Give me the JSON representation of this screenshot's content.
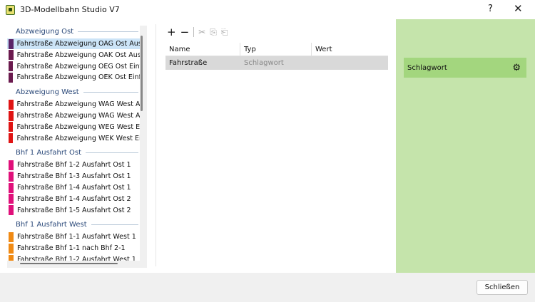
{
  "window": {
    "title": "3D-Modellbahn Studio V7",
    "help": "?",
    "close": "✕"
  },
  "list": {
    "groups": [
      {
        "label": "Abzweigung Ost",
        "color": "#6b1a4e",
        "items": [
          "Fahrstraße Abzweigung OAG Ost Ausf..",
          "Fahrstraße Abzweigung OAK Ost Ausf..",
          "Fahrstraße Abzweigung OEG Ost Einfa..",
          "Fahrstraße Abzweigung OEK Ost Einfa.."
        ]
      },
      {
        "label": "Abzweigung West",
        "color": "#e01414",
        "items": [
          "Fahrstraße Abzweigung WAG West Au..",
          "Fahrstraße Abzweigung WAG West Au..",
          "Fahrstraße Abzweigung WEG West Ein..",
          "Fahrstraße Abzweigung WEK West Ein.."
        ]
      },
      {
        "label": "Bhf 1 Ausfahrt Ost",
        "color": "#e0107a",
        "items": [
          "Fahrstraße Bhf 1-2 Ausfahrt Ost 1",
          "Fahrstraße Bhf 1-3 Ausfahrt Ost 1",
          "Fahrstraße Bhf 1-4 Ausfahrt Ost 1",
          "Fahrstraße Bhf 1-4 Ausfahrt Ost 2",
          "Fahrstraße Bhf 1-5 Ausfahrt Ost 2"
        ]
      },
      {
        "label": "Bhf 1 Ausfahrt West",
        "color": "#f08a14",
        "items": [
          "Fahrstraße Bhf 1-1 Ausfahrt West 1",
          "Fahrstraße Bhf 1-1 nach Bhf 2-1",
          "Fahrstraße Bhf 1-2 Ausfahrt West 1"
        ]
      }
    ],
    "selected_color": "#5a2468"
  },
  "toolbar": {
    "add": "+",
    "remove": "−",
    "cut": "✂",
    "copy": "⎘",
    "paste": "⎗"
  },
  "table": {
    "columns": [
      "Name",
      "Typ",
      "Wert"
    ],
    "rows": [
      [
        "Fahrstraße",
        "Schlagwort",
        ""
      ]
    ]
  },
  "side": {
    "item": "Schlagwort",
    "gear": "⚙"
  },
  "footer": {
    "close_label": "Schließen"
  }
}
